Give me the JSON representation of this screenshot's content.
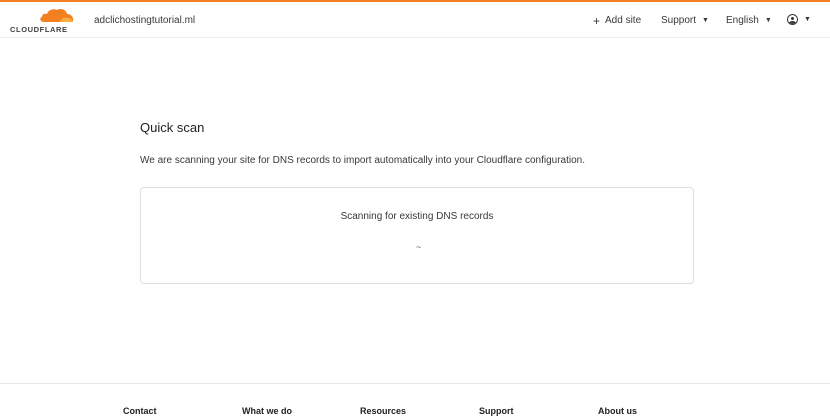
{
  "brand": {
    "wordmark": "CLOUDFLARE",
    "accent": "#f38020"
  },
  "header": {
    "domain": "adclichostingtutorial.ml",
    "add_site": "Add site",
    "support": "Support",
    "language": "English"
  },
  "main": {
    "title": "Quick scan",
    "description": "We are scanning your site for DNS records to import automatically into your Cloudflare configuration.",
    "scan_status": "Scanning for existing DNS records"
  },
  "footer": {
    "columns": [
      "Contact",
      "What we do",
      "Resources",
      "Support",
      "About us"
    ]
  }
}
